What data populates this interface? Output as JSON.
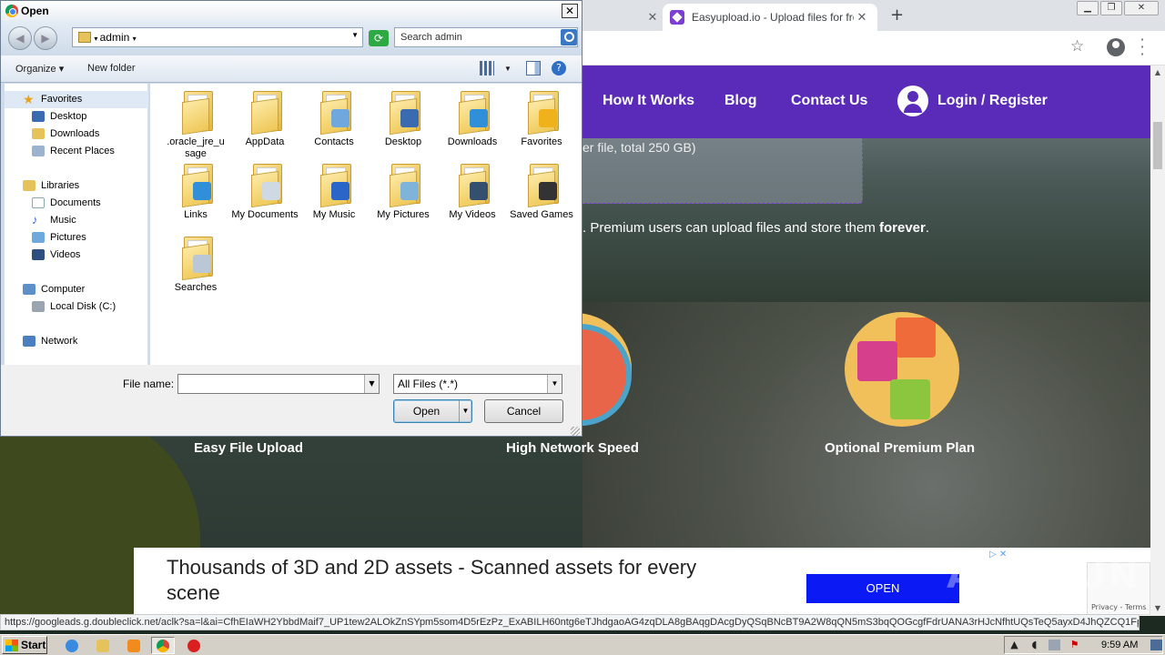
{
  "browser": {
    "tabs": [
      {
        "label": ""
      },
      {
        "label": "Easyupload.io - Upload files for free"
      }
    ],
    "new_tab": "+",
    "window_controls": {
      "minimize": "▁",
      "maximize": "❐",
      "close": "✕"
    },
    "status_url": "https://googleads.g.doubleclick.net/aclk?sa=l&ai=CfhEIaWH2YbbdMaif7_UP1tew2ALOkZnSYpm5som4D5rEzPz_ExABILH60ntg6eTJhdgaoAG4zqDLA8gBAqgDAcgDyQSqBNcBT9A2W8qQN5mS3bqQOGcgfFdrUANA3rHJcNfhtUQsTeQ5ayxD4JhQZCQ1Fpph4wBJ..."
  },
  "site": {
    "nav": {
      "how_it_works": "How It Works",
      "blog": "Blog",
      "contact": "Contact Us",
      "login": "Login / Register"
    },
    "upload_note": "er file, total 250 GB)",
    "premium_note_pre": ". Premium users can upload files and store them ",
    "premium_note_bold": "forever",
    "premium_note_post": ".",
    "features": [
      "Easy File Upload",
      "High Network Speed",
      "Optional Premium Plan"
    ],
    "ad": {
      "title": "Thousands of 3D and 2D assets - Scanned assets for every scene",
      "open_label": "OPEN",
      "choices": "▷ ✕",
      "close": "✕",
      "recaptcha": "Privacy - Terms"
    },
    "watermark": "ANY.RUN"
  },
  "dialog": {
    "title": "Open",
    "close": "✕",
    "address": "admin",
    "search_placeholder": "Search admin",
    "organize": "Organize ▾",
    "new_folder": "New folder",
    "nav": {
      "favorites": "Favorites",
      "fav_items": [
        "Desktop",
        "Downloads",
        "Recent Places"
      ],
      "libraries": "Libraries",
      "lib_items": [
        "Documents",
        "Music",
        "Pictures",
        "Videos"
      ],
      "computer": "Computer",
      "comp_items": [
        "Local Disk (C:)"
      ],
      "network": "Network"
    },
    "files": [
      {
        "name": ".oracle_jre_u sage",
        "icon": "plain-folder"
      },
      {
        "name": "AppData",
        "icon": "plain-folder"
      },
      {
        "name": "Contacts",
        "icon": "contacts-folder"
      },
      {
        "name": "Desktop",
        "icon": "desktop-folder"
      },
      {
        "name": "Downloads",
        "icon": "downloads-folder"
      },
      {
        "name": "Favorites",
        "icon": "favorites-folder"
      },
      {
        "name": "Links",
        "icon": "links-folder"
      },
      {
        "name": "My Documents",
        "icon": "documents-folder"
      },
      {
        "name": "My Music",
        "icon": "music-folder"
      },
      {
        "name": "My Pictures",
        "icon": "pictures-folder"
      },
      {
        "name": "My Videos",
        "icon": "videos-folder"
      },
      {
        "name": "Saved Games",
        "icon": "saved-games-folder"
      },
      {
        "name": "Searches",
        "icon": "searches-folder"
      }
    ],
    "file_name_label": "File name:",
    "file_name_value": "",
    "filter": "All Files (*.*)",
    "open_label": "Open",
    "cancel_label": "Cancel"
  },
  "taskbar": {
    "start": "Start",
    "clock": "9:59 AM"
  },
  "colors": {
    "nav_purple": "#5a2bb8",
    "ad_button": "#0b1af5"
  }
}
